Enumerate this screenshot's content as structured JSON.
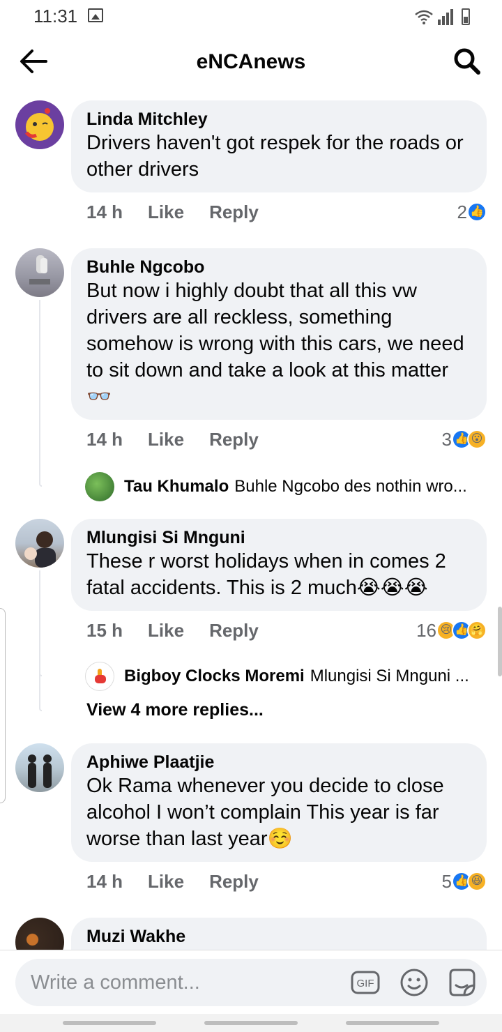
{
  "status_bar": {
    "time": "11:31"
  },
  "header": {
    "title": "eNCAnews"
  },
  "comments": [
    {
      "author": "Linda Mitchley",
      "text": "Drivers haven't got respek for the roads or other drivers",
      "time": "14 h",
      "like_label": "Like",
      "reply_label": "Reply",
      "reaction_count": "2",
      "reactions": [
        "like"
      ]
    },
    {
      "author": "Buhle Ngcobo",
      "text": "But now i highly doubt that all this vw drivers are all reckless, something somehow is wrong with this cars, we need to sit down and take a look at this matter",
      "emoji": "👓",
      "time": "14 h",
      "like_label": "Like",
      "reply_label": "Reply",
      "reaction_count": "3",
      "reactions": [
        "like",
        "wow"
      ],
      "reply_preview": {
        "author": "Tau Khumalo",
        "snippet": "Buhle Ngcobo des nothin wro..."
      }
    },
    {
      "author": "Mlungisi Si Mnguni",
      "text": "These r worst holidays when in comes 2 fatal accidents. This is 2 much",
      "emoji": "😭😭😭",
      "time": "15 h",
      "like_label": "Like",
      "reply_label": "Reply",
      "reaction_count": "16",
      "reactions": [
        "sad",
        "like",
        "care"
      ],
      "reply_preview": {
        "author": "Bigboy Clocks Moremi",
        "snippet": "Mlungisi Si Mnguni ..."
      },
      "more_replies": "View 4 more replies..."
    },
    {
      "author": "Aphiwe Plaatjie",
      "text": "Ok Rama whenever you decide to close alcohol I won’t complain This year is far worse than last year",
      "emoji": "☺️",
      "time": "14 h",
      "like_label": "Like",
      "reply_label": "Reply",
      "reaction_count": "5",
      "reactions": [
        "like",
        "haha"
      ]
    },
    {
      "author": "Muzi Wakhe"
    }
  ],
  "composer": {
    "placeholder": "Write a comment...",
    "gif_label": "GIF"
  },
  "colors": {
    "like_blue": "#1877f2",
    "bubble_gray": "#f0f2f5",
    "meta_gray": "#65676b",
    "reaction_yellow": "#f7b125"
  }
}
